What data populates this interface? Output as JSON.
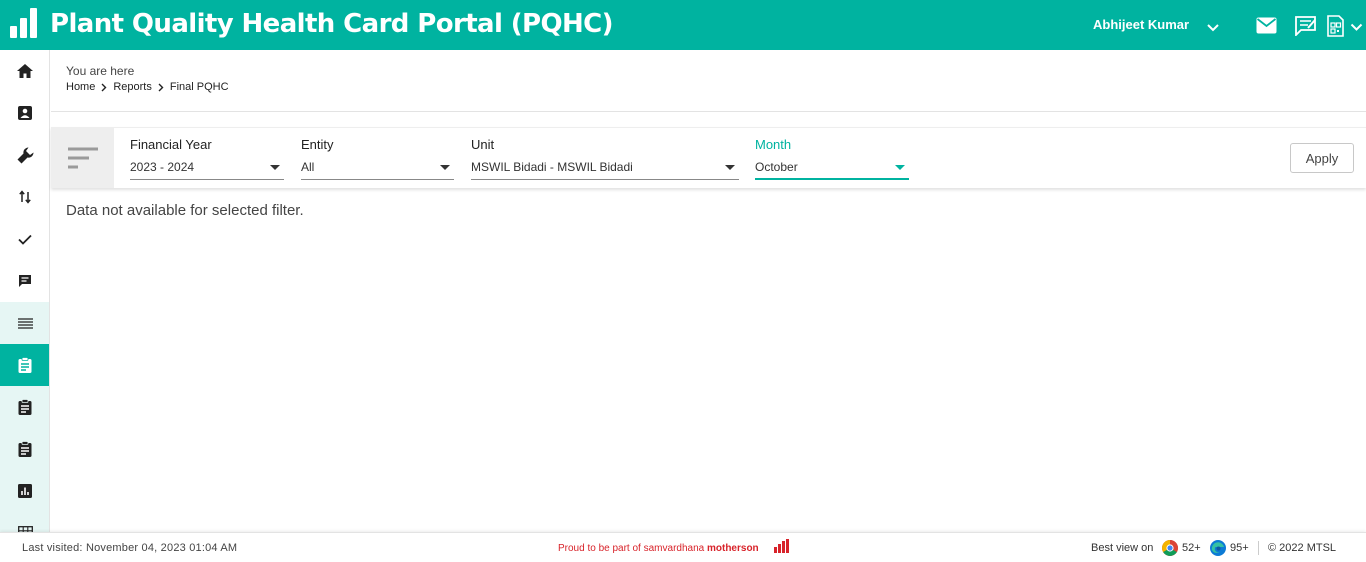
{
  "app": {
    "title": "Plant Quality Health Card Portal (PQHC)",
    "user_name": "Abhijeet Kumar",
    "brand_color": "#00b3a0"
  },
  "header_icons": [
    "mail-icon",
    "feedback-icon",
    "qr-report-icon"
  ],
  "sidebar": {
    "items": [
      {
        "icon": "home-icon"
      },
      {
        "icon": "contact-card-icon"
      },
      {
        "icon": "wrench-icon"
      },
      {
        "icon": "swap-vertical-icon"
      },
      {
        "icon": "check-icon"
      },
      {
        "icon": "message-icon"
      },
      {
        "icon": "list-icon"
      },
      {
        "icon": "clipboard-icon",
        "active": true
      },
      {
        "icon": "clipboard-icon"
      },
      {
        "icon": "clipboard-icon"
      },
      {
        "icon": "bar-chart-icon"
      },
      {
        "icon": "table-icon"
      }
    ]
  },
  "breadcrumb": {
    "heading": "You are here",
    "items": [
      "Home",
      "Reports",
      "Final PQHC"
    ]
  },
  "filters": {
    "financial_year": {
      "label": "Financial Year",
      "value": "2023 - 2024"
    },
    "entity": {
      "label": "Entity",
      "value": "All"
    },
    "unit": {
      "label": "Unit",
      "value": "MSWIL Bidadi - MSWIL Bidadi"
    },
    "month": {
      "label": "Month",
      "value": "October"
    },
    "apply_label": "Apply"
  },
  "main": {
    "message": "Data not available for selected filter."
  },
  "footer": {
    "last_visited": "Last visited: November 04, 2023 01:04 AM",
    "proud_text": "Proud to be part of samvardhana",
    "proud_brand": "motherson",
    "best_view": "Best view on",
    "chrome_version": "52+",
    "edge_version": "95+",
    "copyright": "© 2022 MTSL"
  }
}
